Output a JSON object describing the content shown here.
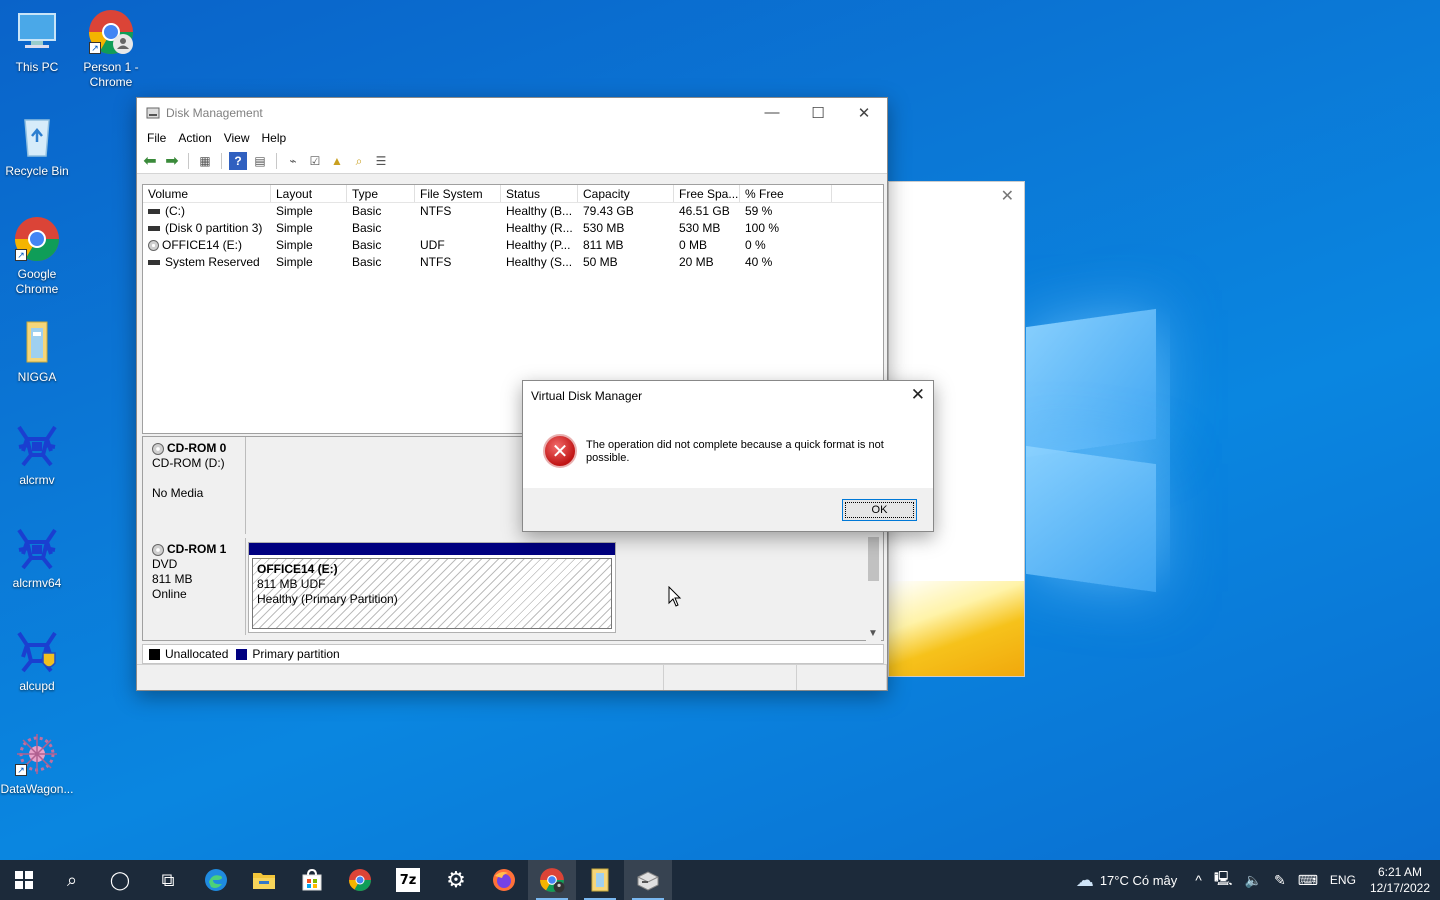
{
  "desktop": {
    "icons": [
      {
        "label": "This PC"
      },
      {
        "label": "Person 1 - Chrome"
      },
      {
        "label": "Recycle Bin"
      },
      {
        "label": "Google Chrome"
      },
      {
        "label": "NIGGA"
      },
      {
        "label": "alcrmv"
      },
      {
        "label": "alcrmv64"
      },
      {
        "label": "alcupd"
      },
      {
        "label": "DataWagon..."
      }
    ]
  },
  "disk_management": {
    "title": "Disk Management",
    "menu": [
      "File",
      "Action",
      "View",
      "Help"
    ],
    "volume_columns": [
      "Volume",
      "Layout",
      "Type",
      "File System",
      "Status",
      "Capacity",
      "Free Spa...",
      "% Free"
    ],
    "volumes": [
      {
        "volume": "(C:)",
        "layout": "Simple",
        "type": "Basic",
        "fs": "NTFS",
        "status": "Healthy (B...",
        "capacity": "79.43 GB",
        "free": "46.51 GB",
        "pct": "59 %"
      },
      {
        "volume": "(Disk 0 partition 3)",
        "layout": "Simple",
        "type": "Basic",
        "fs": "",
        "status": "Healthy (R...",
        "capacity": "530 MB",
        "free": "530 MB",
        "pct": "100 %"
      },
      {
        "volume": "OFFICE14 (E:)",
        "layout": "Simple",
        "type": "Basic",
        "fs": "UDF",
        "status": "Healthy (P...",
        "capacity": "811 MB",
        "free": "0 MB",
        "pct": "0 %"
      },
      {
        "volume": "System Reserved",
        "layout": "Simple",
        "type": "Basic",
        "fs": "NTFS",
        "status": "Healthy (S...",
        "capacity": "50 MB",
        "free": "20 MB",
        "pct": "40 %"
      }
    ],
    "disks": [
      {
        "name": "CD-ROM 0",
        "line1": "CD-ROM (D:)",
        "line2": "",
        "line3": "No Media"
      },
      {
        "name": "CD-ROM 1",
        "line1": "DVD",
        "line2": "811 MB",
        "line3": "Online",
        "partition": {
          "name": "OFFICE14  (E:)",
          "size": "811 MB UDF",
          "status": "Healthy (Primary Partition)"
        }
      }
    ],
    "legend": [
      {
        "label": "Unallocated",
        "color": "#000000"
      },
      {
        "label": "Primary partition",
        "color": "#000080"
      }
    ]
  },
  "dialog": {
    "title": "Virtual Disk Manager",
    "message": "The operation did not complete because a quick format is not possible.",
    "ok_label": "OK"
  },
  "taskbar": {
    "weather": "17°C  Có mây",
    "language": "ENG",
    "time": "6:21 AM",
    "date": "12/17/2022"
  }
}
